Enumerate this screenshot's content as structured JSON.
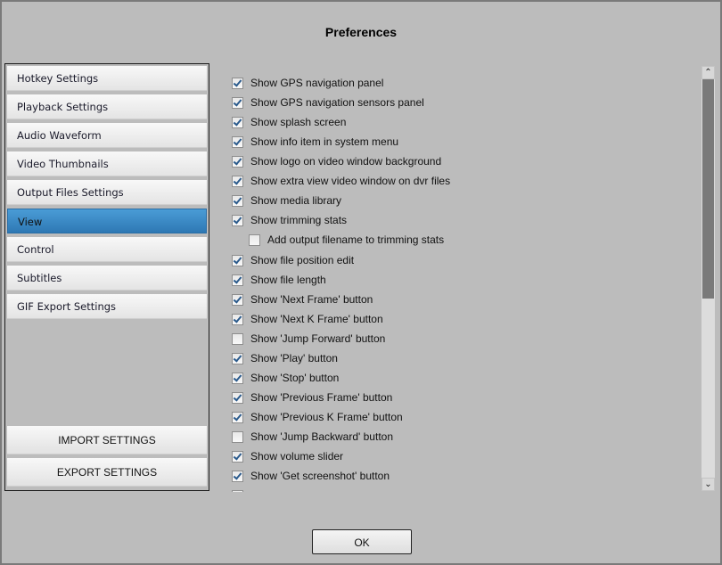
{
  "dialog": {
    "title": "Preferences"
  },
  "sidebar": {
    "items": [
      {
        "label": "Hotkey Settings",
        "active": false
      },
      {
        "label": "Playback Settings",
        "active": false
      },
      {
        "label": "Audio Waveform",
        "active": false
      },
      {
        "label": "Video Thumbnails",
        "active": false
      },
      {
        "label": "Output Files Settings",
        "active": false
      },
      {
        "label": "View",
        "active": true
      },
      {
        "label": "Control",
        "active": false
      },
      {
        "label": "Subtitles",
        "active": false
      },
      {
        "label": "GIF Export Settings",
        "active": false
      }
    ],
    "import_label": "IMPORT SETTINGS",
    "export_label": "EXPORT SETTINGS",
    "active_color": "#3a8ac8"
  },
  "options": [
    {
      "label": "Show GPS navigation panel",
      "checked": true,
      "indent": false
    },
    {
      "label": "Show GPS navigation sensors panel",
      "checked": true,
      "indent": false
    },
    {
      "label": "Show splash screen",
      "checked": true,
      "indent": false
    },
    {
      "label": "Show info item in system menu",
      "checked": true,
      "indent": false
    },
    {
      "label": "Show logo on video window background",
      "checked": true,
      "indent": false
    },
    {
      "label": "Show extra view video window on dvr files",
      "checked": true,
      "indent": false
    },
    {
      "label": "Show media library",
      "checked": true,
      "indent": false
    },
    {
      "label": "Show trimming stats",
      "checked": true,
      "indent": false
    },
    {
      "label": "Add output filename to trimming stats",
      "checked": false,
      "indent": true
    },
    {
      "label": "Show file position edit",
      "checked": true,
      "indent": false
    },
    {
      "label": "Show file length",
      "checked": true,
      "indent": false
    },
    {
      "label": "Show 'Next Frame' button",
      "checked": true,
      "indent": false
    },
    {
      "label": "Show 'Next K Frame' button",
      "checked": true,
      "indent": false
    },
    {
      "label": "Show 'Jump Forward' button",
      "checked": false,
      "indent": false
    },
    {
      "label": "Show 'Play' button",
      "checked": true,
      "indent": false
    },
    {
      "label": "Show 'Stop' button",
      "checked": true,
      "indent": false
    },
    {
      "label": "Show 'Previous Frame' button",
      "checked": true,
      "indent": false
    },
    {
      "label": "Show 'Previous K Frame' button",
      "checked": true,
      "indent": false
    },
    {
      "label": "Show 'Jump Backward' button",
      "checked": false,
      "indent": false
    },
    {
      "label": "Show volume slider",
      "checked": true,
      "indent": false
    },
    {
      "label": "Show 'Get screenshot' button",
      "checked": true,
      "indent": false
    },
    {
      "label": "",
      "checked": true,
      "indent": false
    }
  ],
  "scrollbar": {
    "up_icon": "^",
    "down_icon": "v",
    "scroll_position": 0,
    "visible_fraction": 0.55
  },
  "footer": {
    "ok_label": "OK"
  }
}
